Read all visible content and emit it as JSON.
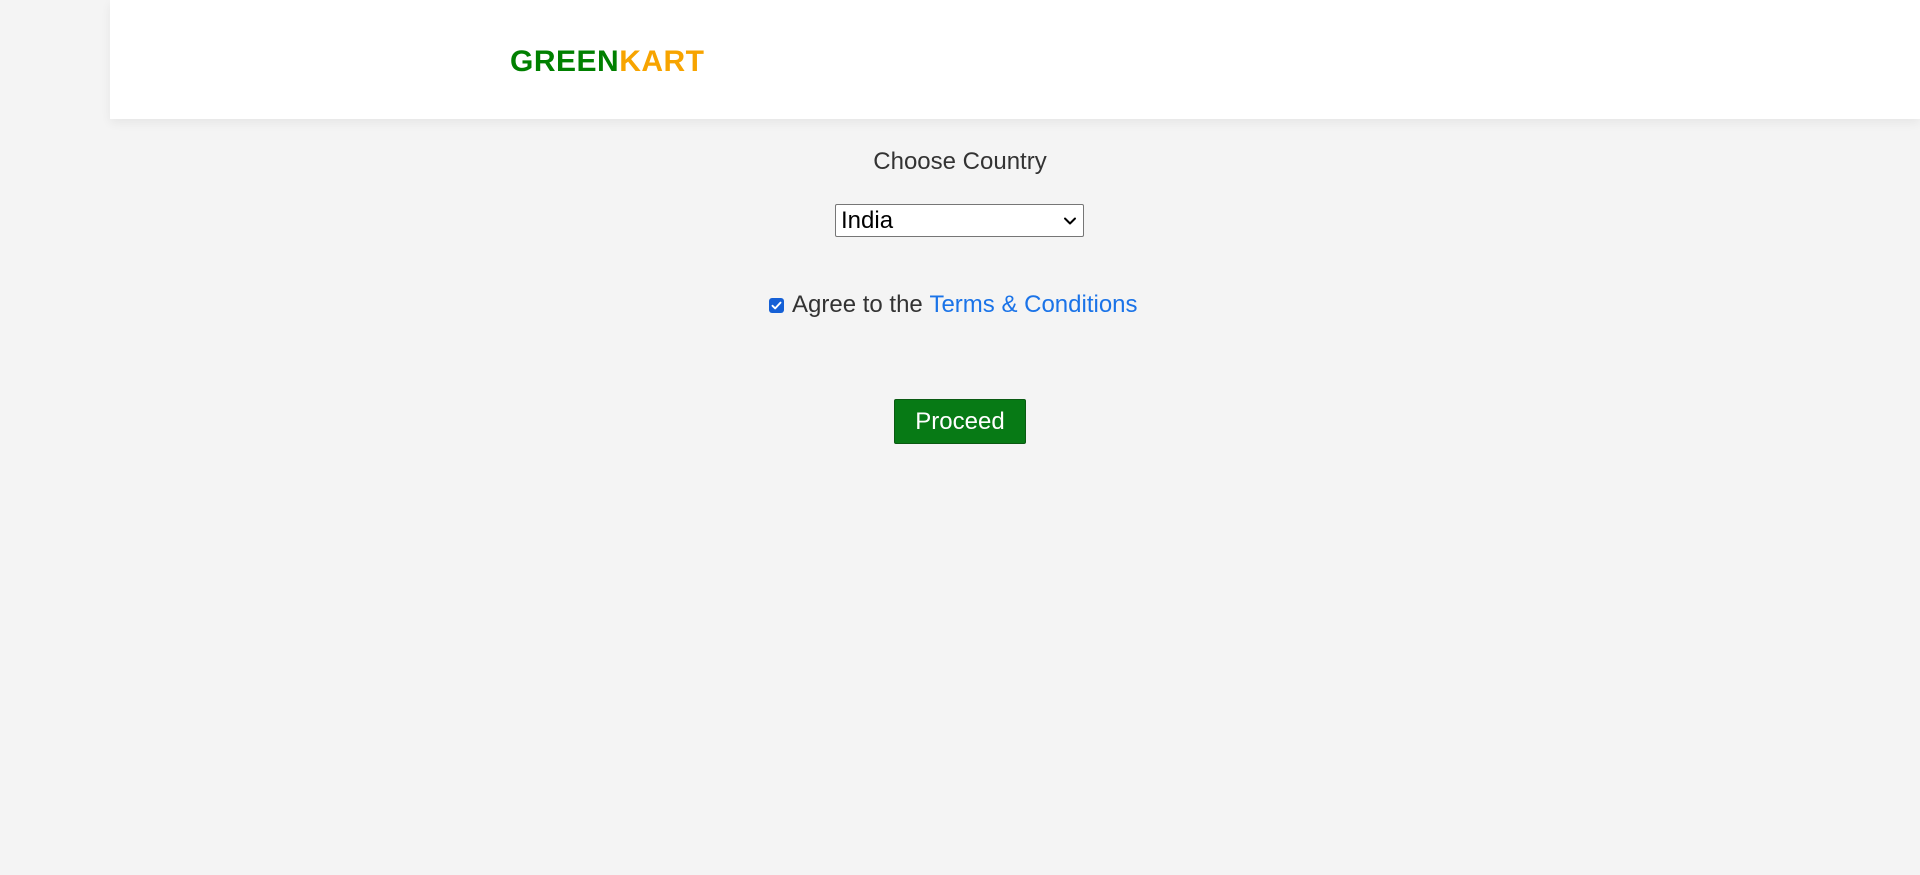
{
  "header": {
    "brand_part1": "GREEN",
    "brand_part2": "KART",
    "brand_colors": {
      "green": "#008000",
      "kart": "#f7a400"
    }
  },
  "form": {
    "choose_country_label": "Choose Country",
    "country_select": {
      "selected_value": "India",
      "icon": "chevron-down-icon"
    },
    "agree": {
      "checked": true,
      "text": "Agree to the ",
      "link_text": "Terms & Conditions",
      "link_color": "#1a73e8",
      "checkbox_color": "#1560d6"
    },
    "proceed_button_label": "Proceed",
    "proceed_button_color": "#077a15"
  },
  "page": {
    "background_color": "#f4f4f4"
  }
}
